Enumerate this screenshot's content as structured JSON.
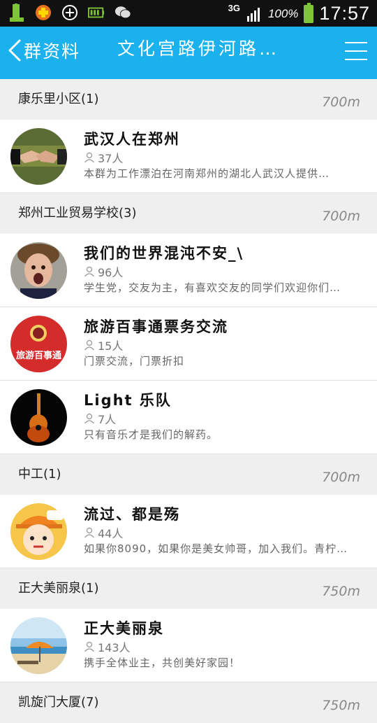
{
  "status_bar": {
    "network": "3G",
    "battery_pct": "100%",
    "time": "17:57",
    "left_icons": [
      "battery-100-icon",
      "medical-box-icon",
      "plus-circle-icon",
      "battery-status-icon",
      "wechat-icon"
    ]
  },
  "header": {
    "back_label": "群资料",
    "title": "文化宫路伊河路…",
    "bg_color": "#1ab1ec"
  },
  "sections": [
    {
      "name": "康乐里小区(1)",
      "distance": "700m",
      "groups": [
        {
          "name": "武汉人在郑州",
          "members": "37人",
          "desc": "本群为工作漂泊在河南郑州的湖北人武汉人提供…",
          "avatar": "handshake"
        }
      ]
    },
    {
      "name": "郑州工业贸易学校(3)",
      "distance": "700m",
      "groups": [
        {
          "name": "我们的世界混沌不安_\\",
          "members": "96人",
          "desc": "学生党，交友为主，有喜欢交友的同学们欢迎你们…",
          "avatar": "face"
        },
        {
          "name": "旅游百事通票务交流",
          "members": "15人",
          "desc": "门票交流，门票折扣",
          "avatar": "travel",
          "avatar_text": "旅游百事通"
        },
        {
          "name": "Light 乐队",
          "members": "7人",
          "desc": "只有音乐才是我们的解药。",
          "avatar": "guitar"
        }
      ]
    },
    {
      "name": "中工(1)",
      "distance": "700m",
      "groups": [
        {
          "name": "流过、都是殇",
          "members": "44人",
          "desc": "如果你8090，如果你是美女帅哥，加入我们。青柠…",
          "avatar": "cartoon"
        }
      ]
    },
    {
      "name": "正大美丽泉(1)",
      "distance": "750m",
      "groups": [
        {
          "name": "正大美丽泉",
          "members": "143人",
          "desc": "携手全体业主，共创美好家园！",
          "avatar": "beach"
        }
      ]
    },
    {
      "name": "凯旋门大厦(7)",
      "distance": "750m",
      "groups": []
    }
  ]
}
